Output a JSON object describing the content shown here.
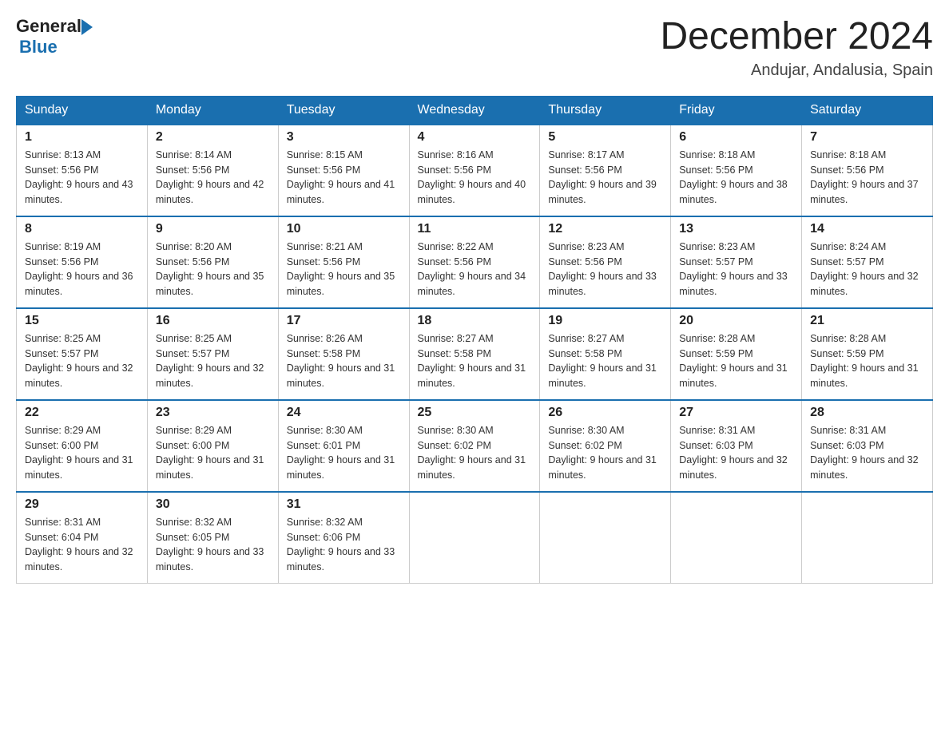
{
  "header": {
    "logo_general": "General",
    "logo_blue": "Blue",
    "month_title": "December 2024",
    "location": "Andujar, Andalusia, Spain"
  },
  "weekdays": [
    "Sunday",
    "Monday",
    "Tuesday",
    "Wednesday",
    "Thursday",
    "Friday",
    "Saturday"
  ],
  "weeks": [
    [
      {
        "day": "1",
        "sunrise": "8:13 AM",
        "sunset": "5:56 PM",
        "daylight": "9 hours and 43 minutes."
      },
      {
        "day": "2",
        "sunrise": "8:14 AM",
        "sunset": "5:56 PM",
        "daylight": "9 hours and 42 minutes."
      },
      {
        "day": "3",
        "sunrise": "8:15 AM",
        "sunset": "5:56 PM",
        "daylight": "9 hours and 41 minutes."
      },
      {
        "day": "4",
        "sunrise": "8:16 AM",
        "sunset": "5:56 PM",
        "daylight": "9 hours and 40 minutes."
      },
      {
        "day": "5",
        "sunrise": "8:17 AM",
        "sunset": "5:56 PM",
        "daylight": "9 hours and 39 minutes."
      },
      {
        "day": "6",
        "sunrise": "8:18 AM",
        "sunset": "5:56 PM",
        "daylight": "9 hours and 38 minutes."
      },
      {
        "day": "7",
        "sunrise": "8:18 AM",
        "sunset": "5:56 PM",
        "daylight": "9 hours and 37 minutes."
      }
    ],
    [
      {
        "day": "8",
        "sunrise": "8:19 AM",
        "sunset": "5:56 PM",
        "daylight": "9 hours and 36 minutes."
      },
      {
        "day": "9",
        "sunrise": "8:20 AM",
        "sunset": "5:56 PM",
        "daylight": "9 hours and 35 minutes."
      },
      {
        "day": "10",
        "sunrise": "8:21 AM",
        "sunset": "5:56 PM",
        "daylight": "9 hours and 35 minutes."
      },
      {
        "day": "11",
        "sunrise": "8:22 AM",
        "sunset": "5:56 PM",
        "daylight": "9 hours and 34 minutes."
      },
      {
        "day": "12",
        "sunrise": "8:23 AM",
        "sunset": "5:56 PM",
        "daylight": "9 hours and 33 minutes."
      },
      {
        "day": "13",
        "sunrise": "8:23 AM",
        "sunset": "5:57 PM",
        "daylight": "9 hours and 33 minutes."
      },
      {
        "day": "14",
        "sunrise": "8:24 AM",
        "sunset": "5:57 PM",
        "daylight": "9 hours and 32 minutes."
      }
    ],
    [
      {
        "day": "15",
        "sunrise": "8:25 AM",
        "sunset": "5:57 PM",
        "daylight": "9 hours and 32 minutes."
      },
      {
        "day": "16",
        "sunrise": "8:25 AM",
        "sunset": "5:57 PM",
        "daylight": "9 hours and 32 minutes."
      },
      {
        "day": "17",
        "sunrise": "8:26 AM",
        "sunset": "5:58 PM",
        "daylight": "9 hours and 31 minutes."
      },
      {
        "day": "18",
        "sunrise": "8:27 AM",
        "sunset": "5:58 PM",
        "daylight": "9 hours and 31 minutes."
      },
      {
        "day": "19",
        "sunrise": "8:27 AM",
        "sunset": "5:58 PM",
        "daylight": "9 hours and 31 minutes."
      },
      {
        "day": "20",
        "sunrise": "8:28 AM",
        "sunset": "5:59 PM",
        "daylight": "9 hours and 31 minutes."
      },
      {
        "day": "21",
        "sunrise": "8:28 AM",
        "sunset": "5:59 PM",
        "daylight": "9 hours and 31 minutes."
      }
    ],
    [
      {
        "day": "22",
        "sunrise": "8:29 AM",
        "sunset": "6:00 PM",
        "daylight": "9 hours and 31 minutes."
      },
      {
        "day": "23",
        "sunrise": "8:29 AM",
        "sunset": "6:00 PM",
        "daylight": "9 hours and 31 minutes."
      },
      {
        "day": "24",
        "sunrise": "8:30 AM",
        "sunset": "6:01 PM",
        "daylight": "9 hours and 31 minutes."
      },
      {
        "day": "25",
        "sunrise": "8:30 AM",
        "sunset": "6:02 PM",
        "daylight": "9 hours and 31 minutes."
      },
      {
        "day": "26",
        "sunrise": "8:30 AM",
        "sunset": "6:02 PM",
        "daylight": "9 hours and 31 minutes."
      },
      {
        "day": "27",
        "sunrise": "8:31 AM",
        "sunset": "6:03 PM",
        "daylight": "9 hours and 32 minutes."
      },
      {
        "day": "28",
        "sunrise": "8:31 AM",
        "sunset": "6:03 PM",
        "daylight": "9 hours and 32 minutes."
      }
    ],
    [
      {
        "day": "29",
        "sunrise": "8:31 AM",
        "sunset": "6:04 PM",
        "daylight": "9 hours and 32 minutes."
      },
      {
        "day": "30",
        "sunrise": "8:32 AM",
        "sunset": "6:05 PM",
        "daylight": "9 hours and 33 minutes."
      },
      {
        "day": "31",
        "sunrise": "8:32 AM",
        "sunset": "6:06 PM",
        "daylight": "9 hours and 33 minutes."
      },
      null,
      null,
      null,
      null
    ]
  ]
}
